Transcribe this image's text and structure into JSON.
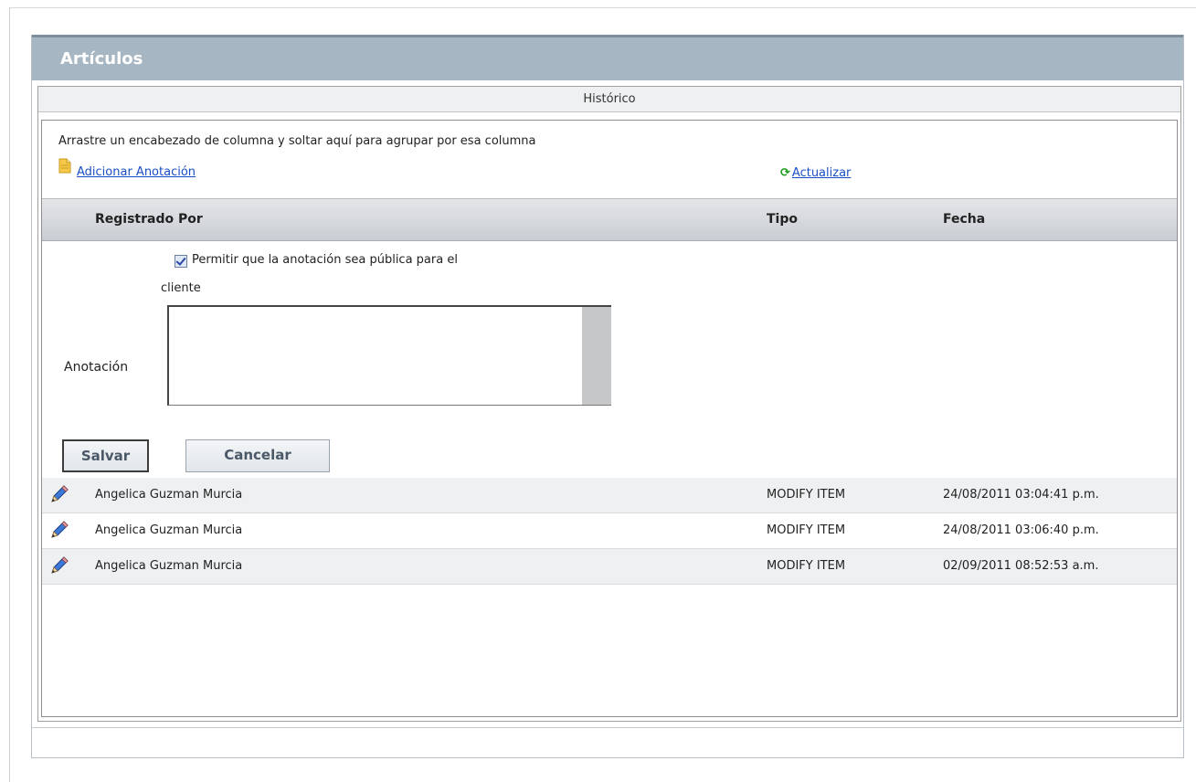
{
  "panel": {
    "title": "Artículos"
  },
  "history": {
    "tab_label": "Histórico",
    "group_hint": "Arrastre un encabezado de columna y soltar aquí para agrupar por esa columna",
    "add_note_label": "Adicionar Anotación",
    "refresh_label": "Actualizar",
    "columns": {
      "registered_by": "Registrado Por",
      "type": "Tipo",
      "date": "Fecha"
    },
    "form": {
      "public_label_line1": "Permitir que la anotación sea pública para el",
      "public_label_line2": "cliente",
      "public_checked": true,
      "note_label": "Anotación",
      "note_value": "",
      "save_label": "Salvar",
      "cancel_label": "Cancelar"
    },
    "rows": [
      {
        "user": "Angelica Guzman Murcia",
        "type": "MODIFY ITEM",
        "date": "24/08/2011 03:04:41 p.m."
      },
      {
        "user": "Angelica Guzman Murcia",
        "type": "MODIFY ITEM",
        "date": "24/08/2011 03:06:40 p.m."
      },
      {
        "user": "Angelica Guzman Murcia",
        "type": "MODIFY ITEM",
        "date": "02/09/2011 08:52:53 a.m."
      }
    ]
  },
  "icons": {
    "add_note": "document-icon",
    "refresh": "refresh-icon",
    "row_edit": "pencil-icon"
  },
  "colors": {
    "header_bar": "#a7b6c3",
    "link": "#1a4fc4",
    "refresh_icon": "#1a9a1a"
  }
}
